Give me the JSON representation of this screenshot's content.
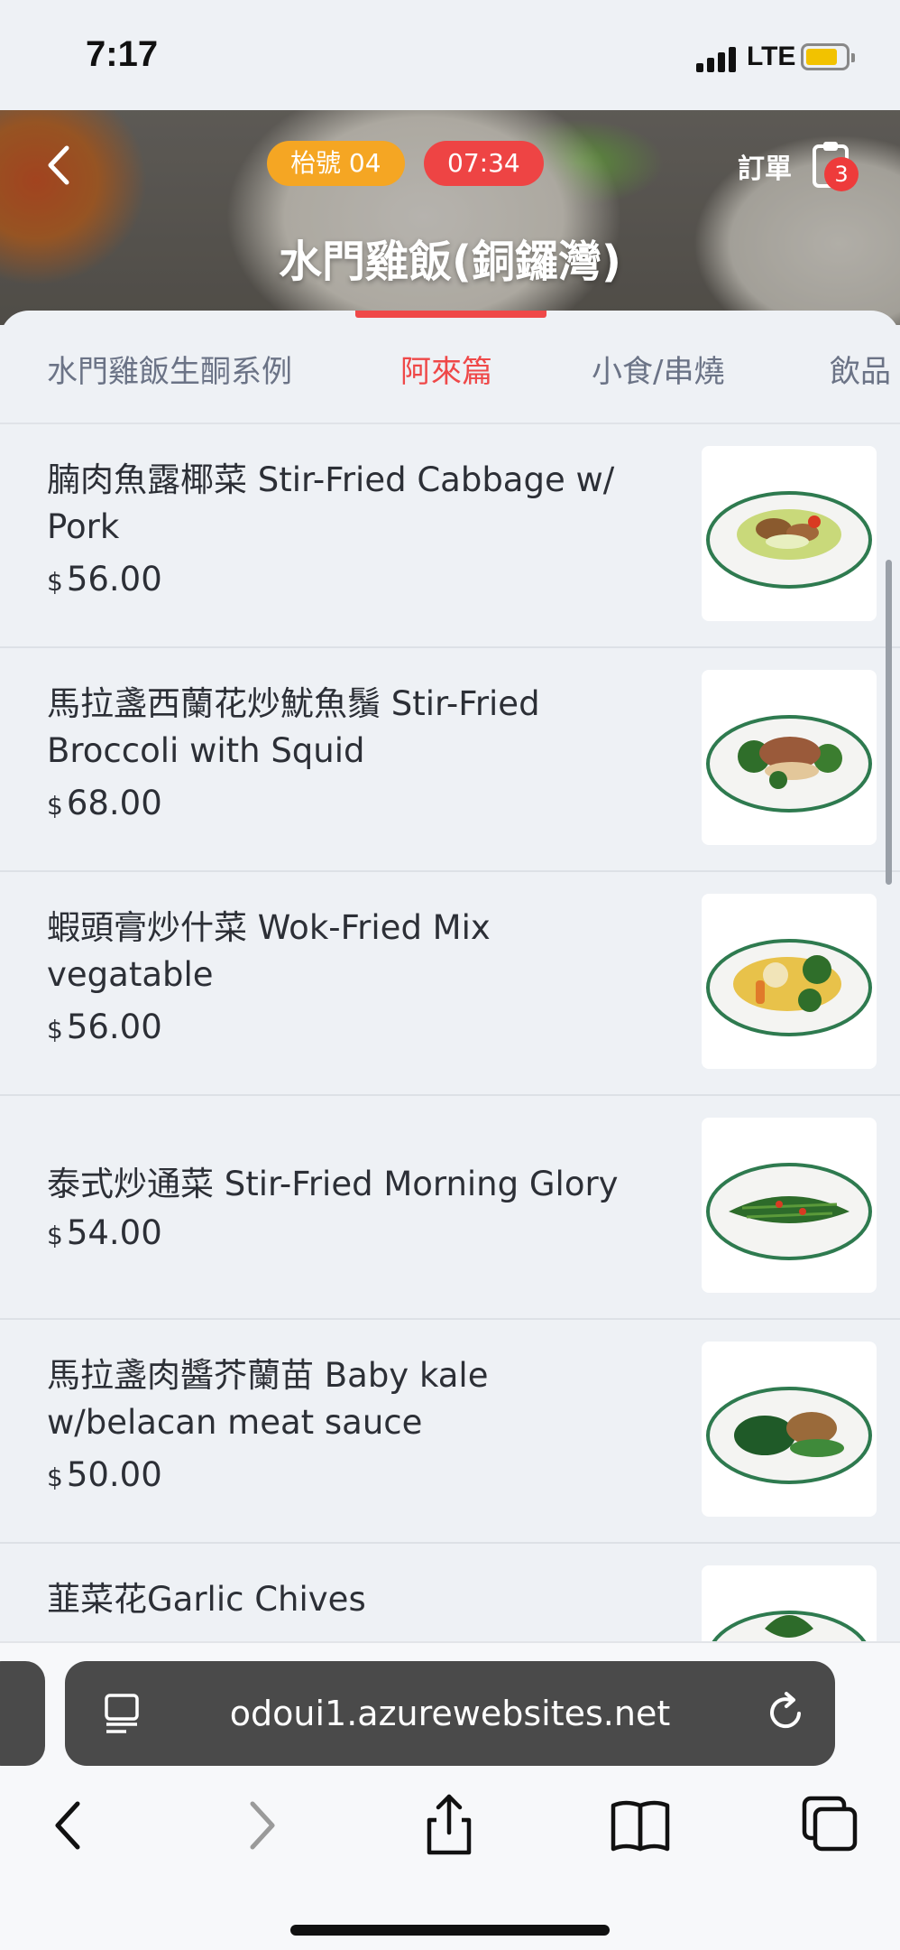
{
  "status_bar": {
    "time": "7:17",
    "network": "LTE"
  },
  "header": {
    "table_label": "枱號 04",
    "timer": "07:34",
    "order_label": "訂單",
    "order_count": "3",
    "store_name": "水門雞飯(銅鑼灣)"
  },
  "tabs": [
    {
      "label": "水門雞飯生酮系例",
      "active": false
    },
    {
      "label": "阿來篇",
      "active": true
    },
    {
      "label": "小食/串燒",
      "active": false
    },
    {
      "label": "飲品",
      "active": false
    }
  ],
  "menu_items": [
    {
      "name": "腩肉魚露椰菜 Stir-Fried Cabbage w/ Pork",
      "currency": "$",
      "price": "56.00"
    },
    {
      "name": "馬拉盞西蘭花炒魷魚鬚 Stir-Fried Broccoli with Squid",
      "currency": "$",
      "price": "68.00"
    },
    {
      "name": "蝦頭膏炒什菜 Wok-Fried Mix vegatable",
      "currency": "$",
      "price": "56.00"
    },
    {
      "name": "泰式炒通菜 Stir-Fried Morning Glory",
      "currency": "$",
      "price": "54.00"
    },
    {
      "name": "馬拉盞肉醬芥蘭苗 Baby kale w/belacan meat sauce",
      "currency": "$",
      "price": "50.00"
    },
    {
      "name": "韮菜花Garlic Chives",
      "currency": "",
      "price": ""
    }
  ],
  "browser": {
    "url": "odoui1.azurewebsites.net"
  },
  "colors": {
    "accent_red": "#ef4848",
    "badge_orange": "#f5a623",
    "background": "#eef1f5"
  }
}
